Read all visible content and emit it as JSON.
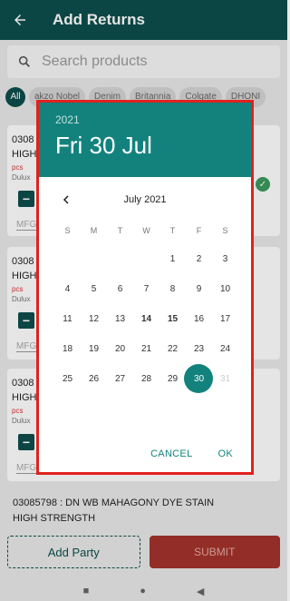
{
  "appbar": {
    "title": "Add Returns",
    "back_icon": "arrow-back-icon"
  },
  "search": {
    "placeholder": "Search products"
  },
  "chips": [
    "All",
    "akzo Nobel",
    "Denim",
    "Britannia",
    "Colgate",
    "DHONI"
  ],
  "cards": [
    {
      "code": "0308",
      "name": "HIGH",
      "unit": "pcs",
      "party": "Dulux",
      "mfg": "MFG"
    },
    {
      "code": "0308",
      "name": "HIGH",
      "unit": "pcs",
      "party": "Dulux",
      "mfg": "MFG"
    },
    {
      "code": "0308",
      "name": "HIGH",
      "unit": "pcs",
      "party": "Dulux",
      "mfg": "MFG"
    }
  ],
  "bottom_item": {
    "line1": "03085798 : DN WB MAHAGONY DYE STAIN",
    "line2": "HIGH STRENGTH"
  },
  "buttons": {
    "add_party": "Add Party",
    "submit": "SUBMIT"
  },
  "datepicker": {
    "year": "2021",
    "selected_date": "Fri 30 Jul",
    "month_label": "July 2021",
    "weekdays": [
      "S",
      "M",
      "T",
      "W",
      "T",
      "F",
      "S"
    ],
    "days": [
      "",
      "",
      "",
      "",
      "1",
      "2",
      "3",
      "4",
      "5",
      "6",
      "7",
      "8",
      "9",
      "10",
      "11",
      "12",
      "13",
      "14",
      "15",
      "16",
      "17",
      "18",
      "19",
      "20",
      "21",
      "22",
      "23",
      "24",
      "25",
      "26",
      "27",
      "28",
      "29",
      "30",
      "31"
    ],
    "selected_day": "30",
    "cancel": "CANCEL",
    "ok": "OK",
    "accent": "#13827d"
  },
  "navbar": {
    "back": "◀",
    "home": "●",
    "recents": "■"
  }
}
